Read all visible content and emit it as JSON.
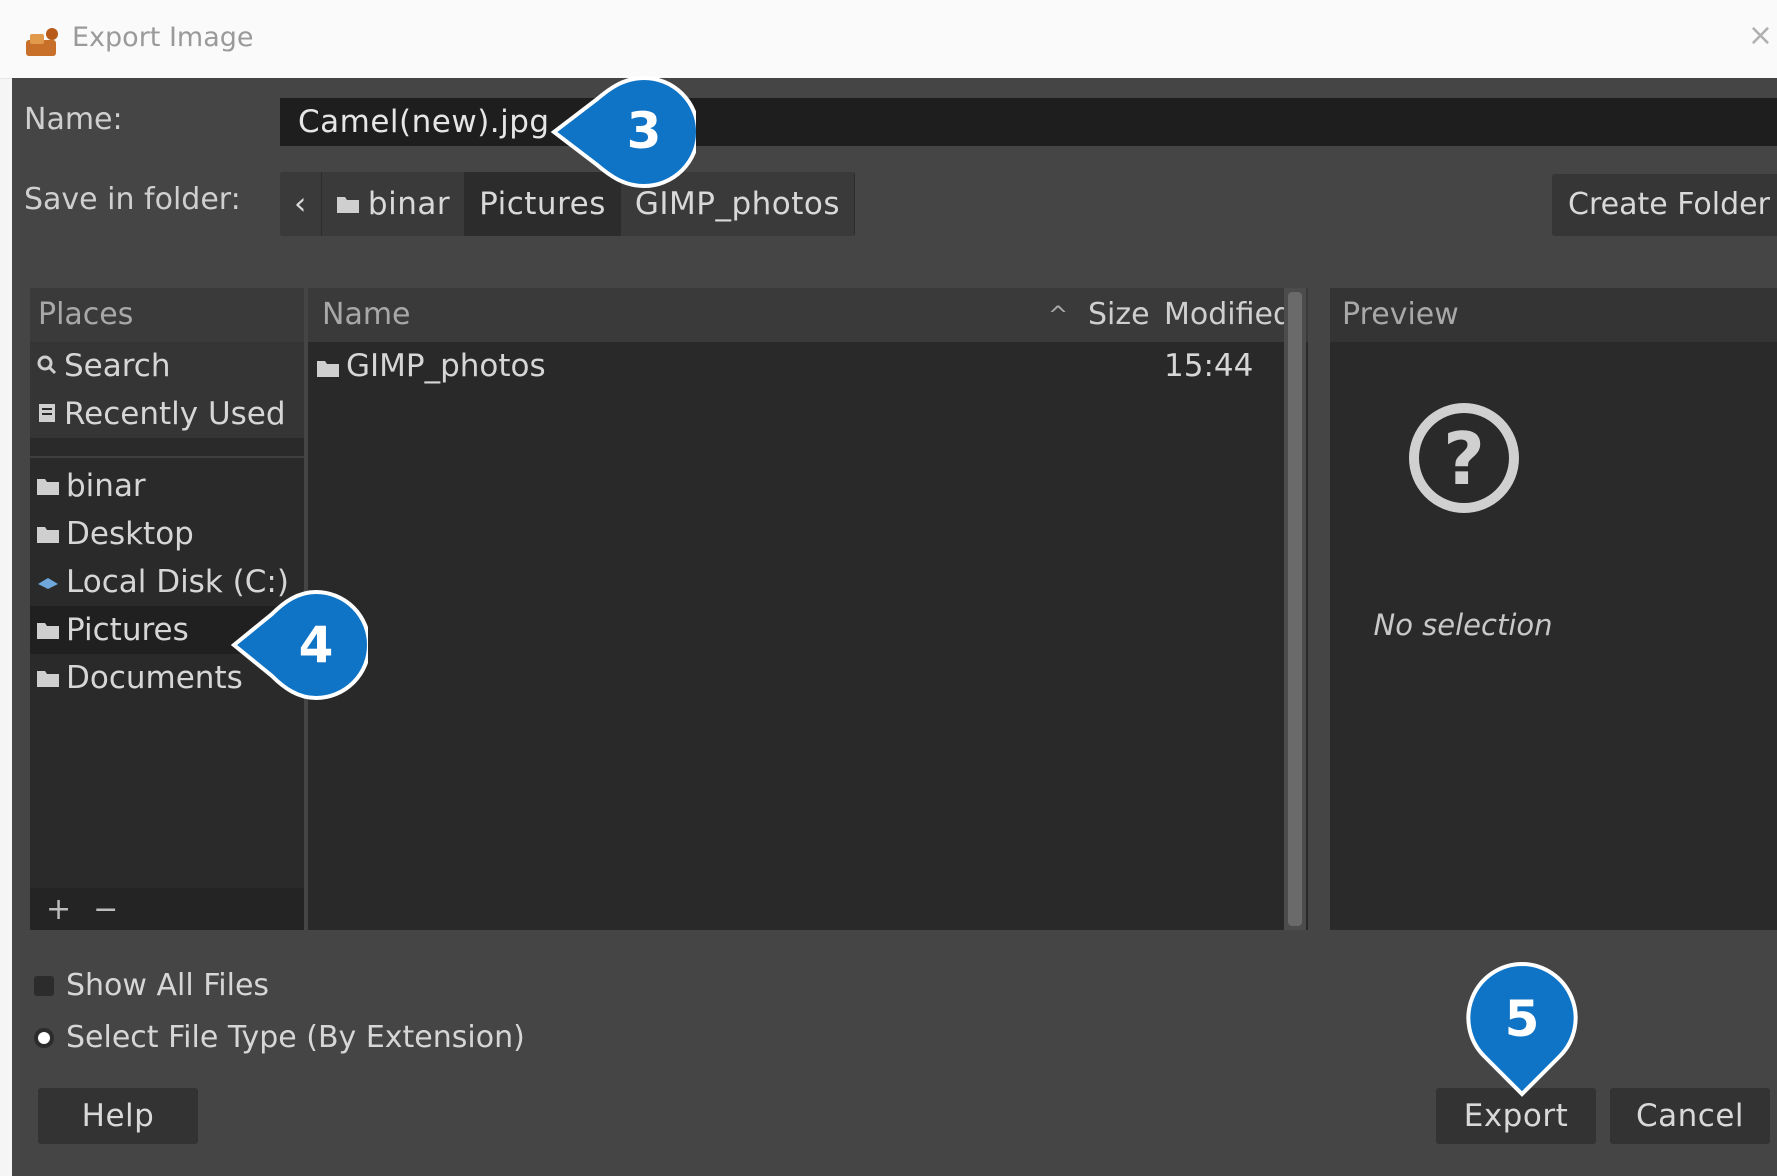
{
  "window": {
    "title": "Export Image",
    "close_glyph": "×"
  },
  "form": {
    "name_label": "Name:",
    "name_value": "Camel(new).jpg",
    "folder_label": "Save in folder:"
  },
  "path_bar": {
    "back_glyph": "‹",
    "segments": [
      "binar",
      "Pictures",
      "GIMP_photos"
    ]
  },
  "create_folder_label": "Create Folder",
  "places": {
    "header": "Places",
    "items": [
      {
        "label": "Search",
        "icon": "search-icon"
      },
      {
        "label": "Recently Used",
        "icon": "recent-icon"
      },
      {
        "label": "binar",
        "icon": "folder-icon"
      },
      {
        "label": "Desktop",
        "icon": "folder-icon"
      },
      {
        "label": "Local Disk (C:)",
        "icon": "drive-icon"
      },
      {
        "label": "Pictures",
        "icon": "folder-icon"
      },
      {
        "label": "Documents",
        "icon": "folder-icon"
      }
    ],
    "add_glyph": "+",
    "remove_glyph": "−"
  },
  "files": {
    "col_name": "Name",
    "col_size": "Size",
    "col_modified": "Modified",
    "sort_glyph": "^",
    "rows": [
      {
        "name": "GIMP_photos",
        "size": "",
        "modified": "15:44",
        "icon": "folder-icon"
      }
    ]
  },
  "preview": {
    "header": "Preview",
    "question_glyph": "?",
    "empty_text": "No selection"
  },
  "options": {
    "show_all_files": "Show All Files",
    "select_file_type": "Select File Type (By Extension)"
  },
  "buttons": {
    "help": "Help",
    "export": "Export",
    "cancel": "Cancel"
  },
  "callouts": [
    "3",
    "4",
    "5"
  ],
  "colors": {
    "callout_fill": "#0f74c6",
    "dialog_bg": "#454545"
  }
}
